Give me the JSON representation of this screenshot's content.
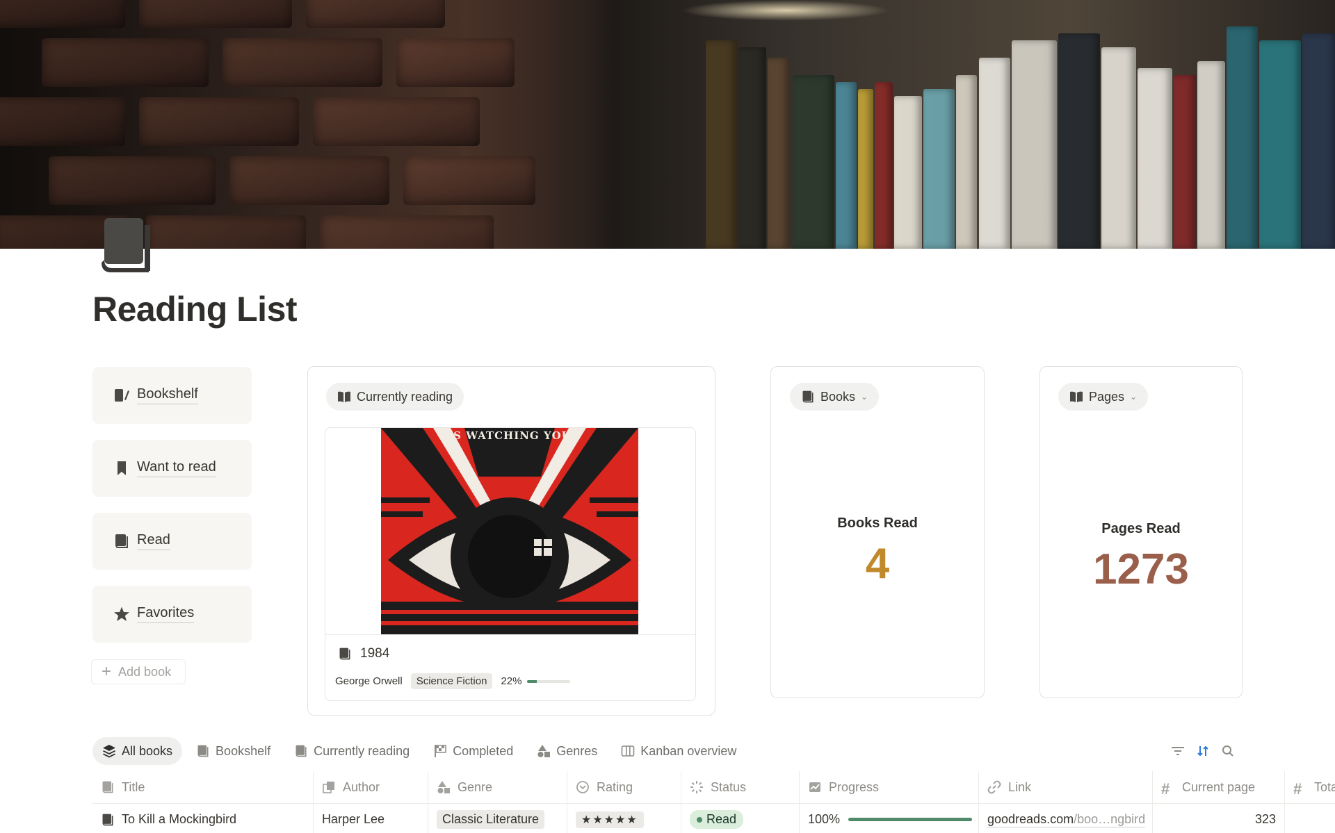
{
  "page": {
    "title": "Reading List"
  },
  "nav": {
    "items": [
      {
        "label": "Bookshelf",
        "icon": "book-pen-icon"
      },
      {
        "label": "Want to read",
        "icon": "bookmark-icon"
      },
      {
        "label": "Read",
        "icon": "book-icon"
      },
      {
        "label": "Favorites",
        "icon": "star-icon"
      }
    ],
    "add_label": "Add book"
  },
  "currently_reading": {
    "pill_label": "Currently reading",
    "cover_text": "IS WATCHING YOU",
    "book": {
      "title": "1984",
      "author": "George Orwell",
      "genre": "Science Fiction",
      "progress_label": "22%",
      "progress": 0.22
    }
  },
  "books_widget": {
    "pill_label": "Books",
    "stat_label": "Books Read",
    "value": "4",
    "value_color": "#c08a2c"
  },
  "pages_widget": {
    "pill_label": "Pages",
    "stat_label": "Pages Read",
    "value": "1273",
    "value_color": "#9a5f4b"
  },
  "tabs": [
    {
      "label": "All books",
      "active": true
    },
    {
      "label": "Bookshelf"
    },
    {
      "label": "Currently reading"
    },
    {
      "label": "Completed"
    },
    {
      "label": "Genres"
    },
    {
      "label": "Kanban overview"
    }
  ],
  "table": {
    "columns": [
      "Title",
      "Author",
      "Genre",
      "Rating",
      "Status",
      "Progress",
      "Link",
      "Current page",
      "Tota"
    ],
    "rows": [
      {
        "title": "To Kill a Mockingbird",
        "author": "Harper Lee",
        "genre": "Classic Literature",
        "rating": "★★★★★",
        "status": "Read",
        "progress_label": "100%",
        "progress": 1.0,
        "link_main": "goodreads.com",
        "link_rest": "/boo…ngbird",
        "current_page": "323"
      }
    ]
  },
  "colors": {
    "accent_green": "#4f8a6a",
    "status_bg": "#dbeddb",
    "nav_bg": "#f7f6f3"
  }
}
